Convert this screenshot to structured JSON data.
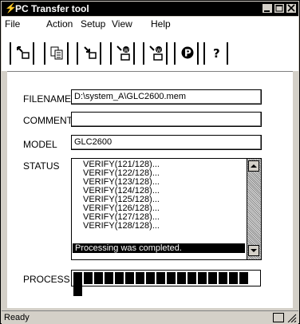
{
  "window": {
    "title": "PC Transfer tool",
    "title_icon": "lightning-icon"
  },
  "menu": [
    "File",
    "Action",
    "Setup",
    "View",
    "Help"
  ],
  "toolbar": [
    {
      "name": "send-icon"
    },
    {
      "name": "copy-icon"
    },
    {
      "name": "receive-icon"
    },
    {
      "name": "setup-send-icon"
    },
    {
      "name": "setup-receive-icon"
    },
    {
      "name": "p-icon"
    },
    {
      "name": "help-icon"
    }
  ],
  "fields": {
    "filename_label": "FILENAME",
    "filename_value": "D:\\system_A\\GLC2600.mem",
    "comment_label": "COMMENT",
    "comment_value": "",
    "model_label": "MODEL",
    "model_value": "GLC2600",
    "status_label": "STATUS",
    "process_label": "PROCESS"
  },
  "status_lines": [
    "VERIFY(121/128)...",
    "VERIFY(122/128)...",
    "VERIFY(123/128)...",
    "VERIFY(124/128)...",
    "VERIFY(125/128)...",
    "VERIFY(126/128)...",
    "VERIFY(127/128)...",
    "VERIFY(128/128)..."
  ],
  "status_done": "Processing was completed.",
  "progress": {
    "value": 1.0,
    "segments": 18
  },
  "statusbar": {
    "text": "Ready"
  }
}
